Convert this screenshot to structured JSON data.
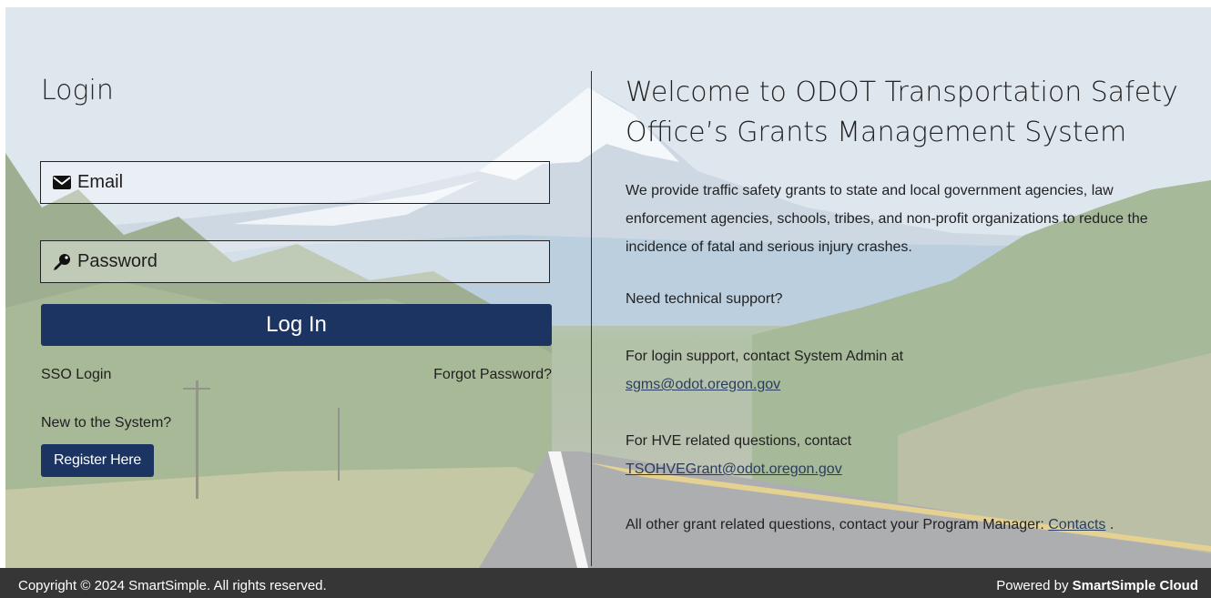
{
  "login": {
    "title": "Login",
    "email_placeholder": "Email",
    "password_placeholder": "Password",
    "login_button": "Log In",
    "sso_link": "SSO Login",
    "forgot_link": "Forgot Password?",
    "new_text": "New to the System?",
    "register_button": "Register Here"
  },
  "info": {
    "title": "Welcome to ODOT Transportation Safety Office’s Grants Management System",
    "intro": "We provide traffic safety grants to state and local government agencies, law enforcement agencies, schools, tribes, and non-profit organizations to reduce the incidence of fatal and serious injury crashes.",
    "support_heading": "Need technical support?",
    "login_support_text": "For login support, contact System Admin at",
    "login_support_email": "sgms@odot.oregon.gov",
    "hve_text": "For HVE related questions, contact",
    "hve_email": "TSOHVEGrant@odot.oregon.gov",
    "other_text": "All other grant related questions, contact your Program Manager:",
    "contacts_link": "Contacts",
    "other_suffix": "."
  },
  "footer": {
    "copyright": "Copyright © 2024 SmartSimple. All rights reserved.",
    "powered_prefix": "Powered by",
    "powered_brand": "SmartSimple Cloud"
  },
  "icons": {
    "email": "envelope-icon",
    "password": "key-icon"
  },
  "colors": {
    "primary_button": "#1b3461",
    "footer_bg": "#363636",
    "link": "#2b3d5e"
  }
}
